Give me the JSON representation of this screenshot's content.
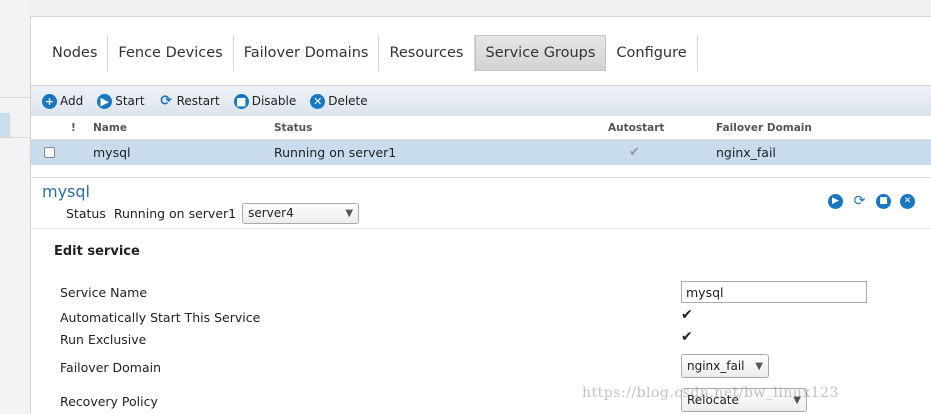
{
  "tabs": [
    {
      "label": "Nodes",
      "active": false
    },
    {
      "label": "Fence Devices",
      "active": false
    },
    {
      "label": "Failover Domains",
      "active": false
    },
    {
      "label": "Resources",
      "active": false
    },
    {
      "label": "Service Groups",
      "active": true
    },
    {
      "label": "Configure",
      "active": false
    }
  ],
  "toolbar": {
    "add": "Add",
    "start": "Start",
    "restart": "Restart",
    "disable": "Disable",
    "delete": "Delete"
  },
  "table": {
    "headers": {
      "flag": "!",
      "name": "Name",
      "status": "Status",
      "autostart": "Autostart",
      "failover_domain": "Failover Domain"
    },
    "rows": [
      {
        "name": "mysql",
        "status": "Running on server1",
        "autostart": true,
        "failover_domain": "nginx_fail"
      }
    ]
  },
  "detail": {
    "title": "mysql",
    "status_label": "Status",
    "status_value": "Running on server1",
    "node_select": "server4"
  },
  "edit": {
    "title": "Edit service",
    "service_name_label": "Service Name",
    "service_name_value": "mysql",
    "autostart_label": "Automatically Start This Service",
    "run_exclusive_label": "Run Exclusive",
    "failover_domain_label": "Failover Domain",
    "failover_domain_value": "nginx_fail",
    "recovery_policy_label": "Recovery Policy",
    "recovery_policy_value": "Relocate"
  },
  "watermark": "https://blog.csdn.net/bw_linux123",
  "colors": {
    "accent": "#1677c4",
    "selected_row": "#c9dcee",
    "title": "#2b6ea8"
  }
}
